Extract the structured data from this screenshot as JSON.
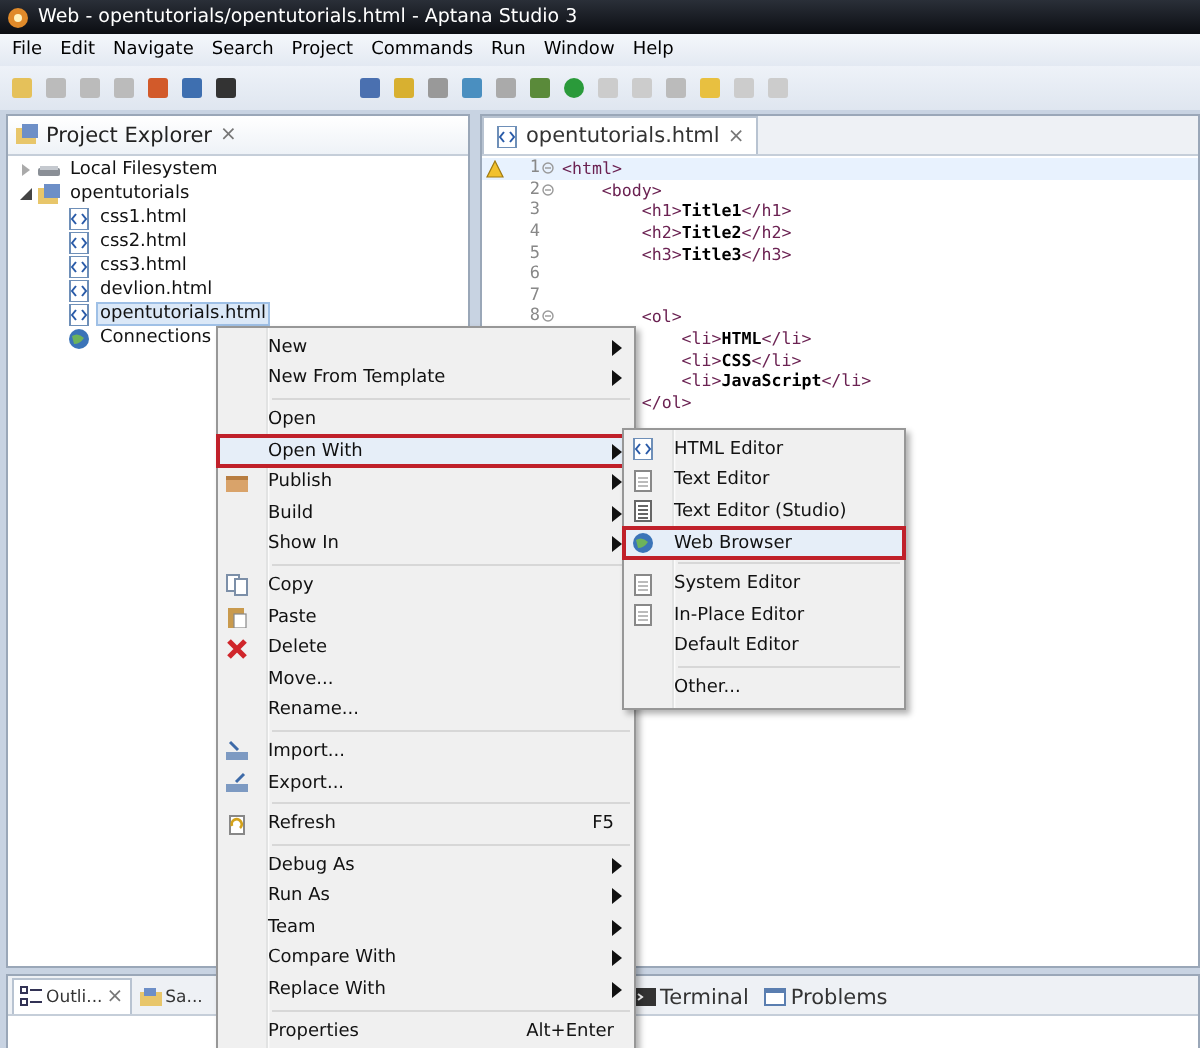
{
  "window": {
    "title": "Web - opentutorials/opentutorials.html - Aptana Studio 3"
  },
  "menu_bar": [
    "File",
    "Edit",
    "Navigate",
    "Search",
    "Project",
    "Commands",
    "Run",
    "Window",
    "Help"
  ],
  "project_explorer": {
    "title": "Project Explorer",
    "close": "×",
    "tree": [
      {
        "label": "Local Filesystem",
        "kind": "drive",
        "expanded": false,
        "selected": false
      },
      {
        "label": "opentutorials",
        "kind": "project",
        "expanded": true,
        "selected": false,
        "children": [
          {
            "label": "css1.html",
            "kind": "html",
            "selected": false
          },
          {
            "label": "css2.html",
            "kind": "html",
            "selected": false
          },
          {
            "label": "css3.html",
            "kind": "html",
            "selected": false
          },
          {
            "label": "devlion.html",
            "kind": "html",
            "selected": false
          },
          {
            "label": "opentutorials.html",
            "kind": "html",
            "selected": true
          },
          {
            "label": "Connections",
            "kind": "globe",
            "selected": false
          }
        ]
      }
    ]
  },
  "editor": {
    "tab": "opentutorials.html",
    "close": "×",
    "lines": [
      {
        "number": "1",
        "fold": true,
        "warning": true,
        "current": true,
        "code": "<html>"
      },
      {
        "number": "2",
        "fold": true,
        "warning": false,
        "current": false,
        "code": "    <body>"
      },
      {
        "number": "3",
        "fold": false,
        "warning": false,
        "current": false,
        "code": "        <h1>**Title1**</h1>"
      },
      {
        "number": "4",
        "fold": false,
        "warning": false,
        "current": false,
        "code": "        <h2>**Title2**</h2>"
      },
      {
        "number": "5",
        "fold": false,
        "warning": false,
        "current": false,
        "code": "        <h3>**Title3**</h3>"
      },
      {
        "number": "6",
        "fold": false,
        "warning": false,
        "current": false
      },
      {
        "number": "7",
        "fold": false,
        "warning": false,
        "current": false
      },
      {
        "number": "8",
        "fold": true,
        "warning": false,
        "current": false,
        "code": "        <ol>"
      },
      {
        "current": false,
        "code": "            <li>**HTML**</li>"
      },
      {
        "current": false,
        "code": "            <li>**CSS**</li>"
      },
      {
        "current": false,
        "code": "            <li>**JavaScript**</li>"
      },
      {
        "current": false,
        "code": "        </ol>"
      }
    ]
  },
  "bottom_left_tabs": [
    {
      "label": "Outli...",
      "kind": "outline",
      "selected": true,
      "close": "×"
    },
    {
      "label": "Sa...",
      "kind": "samples",
      "selected": false
    }
  ],
  "bottom_right_tabs": [
    {
      "label": "Terminal",
      "kind": "terminal",
      "selected": false
    },
    {
      "label": "Problems",
      "kind": "problems",
      "selected": false
    }
  ],
  "context_menu": [
    {
      "kind": "plain",
      "label": "New",
      "submenu": true,
      "highlighted": false
    },
    {
      "kind": "plain",
      "label": "New From Template",
      "submenu": true,
      "highlighted": false
    },
    {
      "kind": "separator"
    },
    {
      "kind": "plain",
      "label": "Open",
      "submenu": false,
      "highlighted": false
    },
    {
      "kind": "plain",
      "label": "Open With",
      "submenu": true,
      "highlighted": true
    },
    {
      "kind": "publish",
      "label": "Publish",
      "submenu": true,
      "highlighted": false
    },
    {
      "kind": "plain",
      "label": "Build",
      "submenu": true,
      "highlighted": false
    },
    {
      "kind": "plain",
      "label": "Show In",
      "submenu": true,
      "highlighted": false
    },
    {
      "kind": "separator"
    },
    {
      "kind": "copy",
      "label": "Copy",
      "submenu": false,
      "highlighted": false
    },
    {
      "kind": "paste",
      "label": "Paste",
      "submenu": false,
      "highlighted": false
    },
    {
      "kind": "delete",
      "label": "Delete",
      "submenu": false,
      "highlighted": false
    },
    {
      "kind": "plain",
      "label": "Move...",
      "submenu": false,
      "highlighted": false
    },
    {
      "kind": "plain",
      "label": "Rename...",
      "submenu": false,
      "highlighted": false
    },
    {
      "kind": "separator"
    },
    {
      "kind": "import",
      "label": "Import...",
      "submenu": false,
      "highlighted": false
    },
    {
      "kind": "export",
      "label": "Export...",
      "submenu": false,
      "highlighted": false
    },
    {
      "kind": "separator"
    },
    {
      "kind": "refresh",
      "label": "Refresh",
      "shortcut": "F5",
      "submenu": false,
      "highlighted": false
    },
    {
      "kind": "separator"
    },
    {
      "kind": "plain",
      "label": "Debug As",
      "submenu": true,
      "highlighted": false
    },
    {
      "kind": "plain",
      "label": "Run As",
      "submenu": true,
      "highlighted": false
    },
    {
      "kind": "plain",
      "label": "Team",
      "submenu": true,
      "highlighted": false
    },
    {
      "kind": "plain",
      "label": "Compare With",
      "submenu": true,
      "highlighted": false
    },
    {
      "kind": "plain",
      "label": "Replace With",
      "submenu": true,
      "highlighted": false
    },
    {
      "kind": "separator"
    },
    {
      "kind": "plain",
      "label": "Properties",
      "shortcut": "Alt+Enter",
      "submenu": false,
      "highlighted": false
    }
  ],
  "open_with_menu": [
    {
      "kind": "html",
      "label": "HTML Editor",
      "highlighted": false
    },
    {
      "kind": "text",
      "label": "Text Editor",
      "highlighted": false
    },
    {
      "kind": "lines",
      "label": "Text Editor (Studio)",
      "highlighted": false
    },
    {
      "kind": "globe",
      "label": "Web Browser",
      "highlighted": true
    },
    {
      "kind": "separator"
    },
    {
      "kind": "text",
      "label": "System Editor",
      "highlighted": false
    },
    {
      "kind": "text",
      "label": "In-Place Editor",
      "highlighted": false
    },
    {
      "kind": "plain",
      "label": "Default Editor",
      "highlighted": false
    },
    {
      "kind": "separator"
    },
    {
      "kind": "plain",
      "label": "Other...",
      "highlighted": false
    }
  ]
}
